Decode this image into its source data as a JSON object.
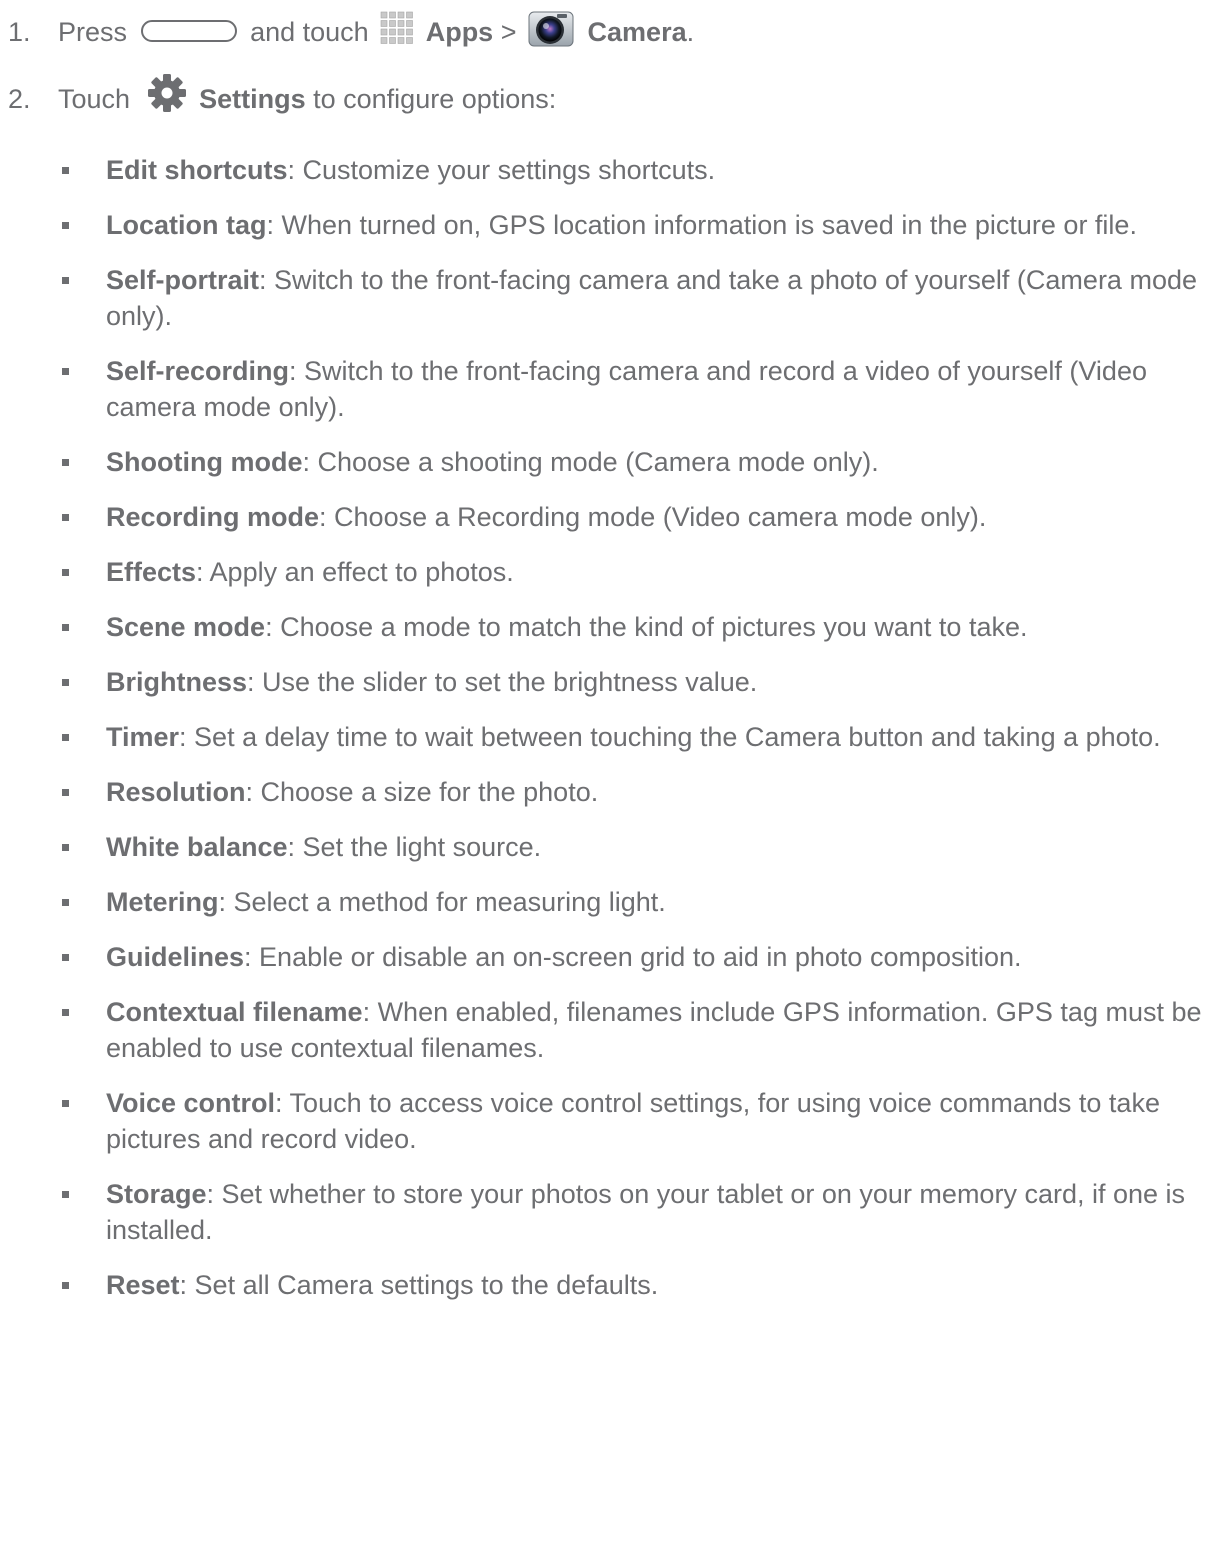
{
  "steps": [
    {
      "number": "1.",
      "press": "Press",
      "and_touch": "and touch",
      "apps": "Apps",
      "separator": ">",
      "camera": "Camera",
      "end": "."
    },
    {
      "number": "2.",
      "touch": "Touch",
      "settings": "Settings",
      "rest": "to configure options:"
    }
  ],
  "options": [
    {
      "term": "Edit shortcuts",
      "desc": ": Customize your settings shortcuts."
    },
    {
      "term": "Location tag",
      "desc": ": When turned on, GPS location information is saved in the picture or file."
    },
    {
      "term": "Self-portrait",
      "desc": ": Switch to the front-facing camera and take a photo of yourself (Camera mode only)."
    },
    {
      "term": "Self-recording",
      "desc": ": Switch to the front-facing camera and record a video of yourself (Video camera mode only)."
    },
    {
      "term": "Shooting mode",
      "desc": ": Choose a shooting mode (Camera mode only)."
    },
    {
      "term": "Recording mode",
      "desc": ": Choose a Recording mode (Video camera mode only)."
    },
    {
      "term": "Effects",
      "desc": ": Apply an effect to photos."
    },
    {
      "term": "Scene mode",
      "desc": ": Choose a mode to match the kind of pictures you want to take."
    },
    {
      "term": "Brightness",
      "desc": ": Use the slider to set the brightness value."
    },
    {
      "term": "Timer",
      "desc": ": Set a delay time to wait between touching the Camera button and taking a photo."
    },
    {
      "term": "Resolution",
      "desc": ": Choose a size for the photo."
    },
    {
      "term": "White balance",
      "desc": ": Set the light source."
    },
    {
      "term": "Metering",
      "desc": ": Select a method for measuring light."
    },
    {
      "term": "Guidelines",
      "desc": ": Enable or disable an on-screen grid to aid in photo composition."
    },
    {
      "term": "Contextual filename",
      "desc": ": When enabled, filenames include GPS information. GPS tag must be enabled to use contextual filenames."
    },
    {
      "term": "Voice control",
      "desc": ": Touch to access voice control settings, for using voice commands to take pictures and record video."
    },
    {
      "term": "Storage",
      "desc": ": Set whether to store your photos on your tablet or on your memory card, if one is installed."
    },
    {
      "term": "Reset",
      "desc": ": Set all Camera settings to the defaults."
    }
  ],
  "icons": {
    "home_key": "home-key-icon",
    "apps": "apps-grid-icon",
    "camera": "camera-app-icon",
    "settings": "gear-icon"
  },
  "colors": {
    "text": "#6d6e71"
  }
}
